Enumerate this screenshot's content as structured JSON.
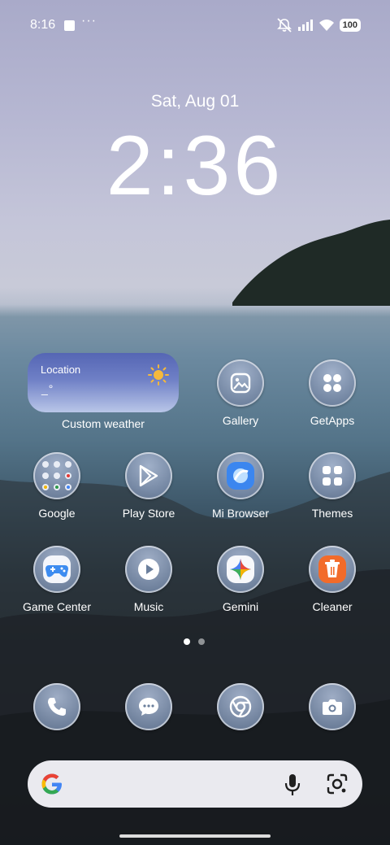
{
  "status_bar": {
    "time": "8:16",
    "overflow": "···",
    "battery": "100",
    "icons": [
      "notification-square-icon",
      "mute-icon",
      "signal-icon",
      "wifi-icon",
      "battery-icon"
    ]
  },
  "lockscreen": {
    "date": "Sat, Aug 01",
    "time": "2:36"
  },
  "weather_widget": {
    "location": "Location",
    "temperature": "_°",
    "icon": "sun-icon",
    "label": "Custom weather"
  },
  "apps": {
    "gallery": "Gallery",
    "getapps": "GetApps",
    "google": "Google",
    "play_store": "Play Store",
    "mi_browser": "Mi Browser",
    "themes": "Themes",
    "game_center": "Game Center",
    "music": "Music",
    "gemini": "Gemini",
    "cleaner": "Cleaner"
  },
  "dock": [
    "phone-icon",
    "messages-icon",
    "chrome-icon",
    "camera-icon"
  ],
  "pager": {
    "pages": 2,
    "current": 1
  },
  "search_bar": {
    "icons": [
      "google-g-icon",
      "microphone-icon",
      "google-lens-icon"
    ]
  },
  "colors": {
    "widget_top": "#5566b4",
    "cleaner_orange": "#f26b2a",
    "mi_browser_blue": "#3b86ef",
    "sun": "#f6b93b"
  }
}
